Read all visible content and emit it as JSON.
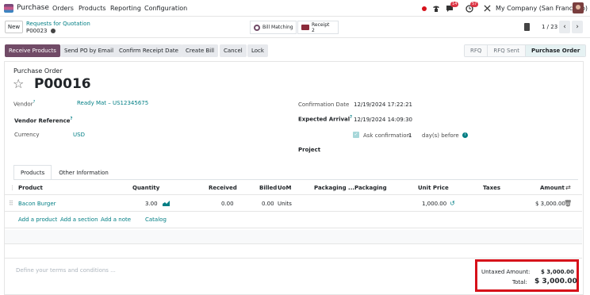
{
  "nav": {
    "app": "Purchase",
    "menu": [
      "Orders",
      "Products",
      "Reporting",
      "Configuration"
    ],
    "chat_count": "14",
    "activity_count": "57",
    "company": "My Company (San Francisco)"
  },
  "control": {
    "new_label": "New",
    "breadcrumb_parent": "Requests for Quotation",
    "breadcrumb_current": "P00023",
    "bill_matching": "Bill Matching",
    "receipt_label": "Receipt",
    "receipt_count": "2",
    "pager": "1 / 23"
  },
  "actions": [
    "Receive Products",
    "Send PO by Email",
    "Confirm Receipt Date",
    "Create Bill",
    "Cancel",
    "Lock"
  ],
  "statusbar": [
    "RFQ",
    "RFQ Sent",
    "Purchase Order"
  ],
  "form": {
    "doc_type": "Purchase Order",
    "name": "P00016",
    "vendor_label": "Vendor",
    "vendor": "Ready Mat – US12345675",
    "vendor_ref_label": "Vendor Reference",
    "currency_label": "Currency",
    "currency": "USD",
    "confirmation_date_label": "Confirmation Date",
    "confirmation_date": "12/19/2024 17:22:21",
    "expected_arrival_label": "Expected Arrival",
    "expected_arrival": "12/19/2024 14:09:30",
    "ask_confirmation_label": "Ask confirmation",
    "ask_confirmation_days": "1",
    "days_before": "day(s) before",
    "project_label": "Project"
  },
  "tabs": [
    "Products",
    "Other Information"
  ],
  "table": {
    "headers": [
      "Product",
      "Quantity",
      "Received",
      "Billed",
      "UoM",
      "Packaging ...",
      "Packaging",
      "Unit Price",
      "Taxes",
      "Amount"
    ],
    "rows": [
      {
        "product": "Bacon Burger",
        "quantity": "3.00",
        "received": "0.00",
        "billed": "0.00",
        "uom": "Units",
        "unit_price": "1,000.00",
        "taxes": "",
        "amount": "$ 3,000.00"
      }
    ],
    "add_links": [
      "Add a product",
      "Add a section",
      "Add a note",
      "Catalog"
    ]
  },
  "footer": {
    "terms_placeholder": "Define your terms and conditions ...",
    "untaxed_label": "Untaxed Amount:",
    "untaxed_value": "$ 3,000.00",
    "total_label": "Total:",
    "total_value": "$ 3,000.00"
  },
  "colors": {
    "brand": "#714b67",
    "link": "#017e84",
    "highlight": "#d6111a"
  }
}
